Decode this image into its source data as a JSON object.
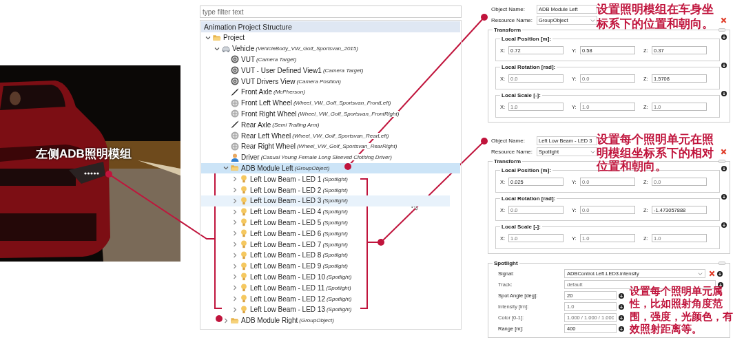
{
  "photo_caption": "左侧ADB照明模组",
  "filter": {
    "placeholder": "type filter text"
  },
  "tree": {
    "title": "Animation Project Structure",
    "items": [
      {
        "label": "Project",
        "kind": "folder",
        "expandable": true,
        "expanded": true,
        "selected": false,
        "hovered": false,
        "children": [
          {
            "label": "Vehicle",
            "type": "(VehicleBody_VW_Golf_Sportsvan_2015)",
            "kind": "car",
            "expandable": true,
            "expanded": true,
            "selected": false,
            "hovered": false,
            "children": [
              {
                "label": "VUT",
                "type": "(Camera Target)",
                "kind": "target",
                "expandable": false,
                "selected": false,
                "hovered": false
              },
              {
                "label": "VUT - User Defined View1",
                "type": "(Camera Target)",
                "kind": "target",
                "expandable": false,
                "selected": false,
                "hovered": false
              },
              {
                "label": "VUT Drivers View",
                "type": "(Camera Position)",
                "kind": "target",
                "expandable": false,
                "selected": false,
                "hovered": false
              },
              {
                "label": "Front Axle",
                "type": "(McPherson)",
                "kind": "axle",
                "expandable": false,
                "selected": false,
                "hovered": false
              },
              {
                "label": "Front Left Wheel",
                "type": "(Wheel_VW_Golf_Sportsvan_FrontLeft)",
                "kind": "wheel",
                "expandable": false,
                "selected": false,
                "hovered": false
              },
              {
                "label": "Front Right Wheel",
                "type": "(Wheel_VW_Golf_Sportsvan_FrontRight)",
                "kind": "wheel",
                "expandable": false,
                "selected": false,
                "hovered": false
              },
              {
                "label": "Rear Axle",
                "type": "(Semi Trailing Arm)",
                "kind": "axle",
                "expandable": false,
                "selected": false,
                "hovered": false
              },
              {
                "label": "Rear Left Wheel",
                "type": "(Wheel_VW_Golf_Sportsvan_RearLeft)",
                "kind": "wheel",
                "expandable": false,
                "selected": false,
                "hovered": false
              },
              {
                "label": "Rear Right Wheel",
                "type": "(Wheel_VW_Golf_Sportsvan_RearRight)",
                "kind": "wheel",
                "expandable": false,
                "selected": false,
                "hovered": false
              },
              {
                "label": "Driver",
                "type": "(Casual Young Female Long Sleeved Clothing Driver)",
                "kind": "person",
                "expandable": false,
                "selected": false,
                "hovered": false
              },
              {
                "label": "ADB Module Left",
                "type": "(GroupObject)",
                "kind": "folder",
                "expandable": true,
                "expanded": true,
                "selected": true,
                "hovered": false,
                "children": [
                  {
                    "label": "Left Low Beam - LED 1",
                    "type": "(Spotlight)",
                    "kind": "bulb",
                    "expandable": true,
                    "expanded": false,
                    "selected": false,
                    "hovered": false
                  },
                  {
                    "label": "Left Low Beam - LED 2",
                    "type": "(Spotlight)",
                    "kind": "bulb",
                    "expandable": true,
                    "expanded": false,
                    "selected": false,
                    "hovered": false
                  },
                  {
                    "label": "Left Low Beam - LED 3",
                    "type": "(Spotlight)",
                    "kind": "bulb",
                    "expandable": true,
                    "expanded": false,
                    "selected": false,
                    "hovered": true
                  },
                  {
                    "label": "Left Low Beam - LED 4",
                    "type": "(Spotlight)",
                    "kind": "bulb",
                    "expandable": true,
                    "expanded": false,
                    "selected": false,
                    "hovered": false
                  },
                  {
                    "label": "Left Low Beam - LED 5",
                    "type": "(Spotlight)",
                    "kind": "bulb",
                    "expandable": true,
                    "expanded": false,
                    "selected": false,
                    "hovered": false
                  },
                  {
                    "label": "Left Low Beam - LED 6",
                    "type": "(Spotlight)",
                    "kind": "bulb",
                    "expandable": true,
                    "expanded": false,
                    "selected": false,
                    "hovered": false
                  },
                  {
                    "label": "Left Low Beam - LED 7",
                    "type": "(Spotlight)",
                    "kind": "bulb",
                    "expandable": true,
                    "expanded": false,
                    "selected": false,
                    "hovered": false
                  },
                  {
                    "label": "Left Low Beam - LED 8",
                    "type": "(Spotlight)",
                    "kind": "bulb",
                    "expandable": true,
                    "expanded": false,
                    "selected": false,
                    "hovered": false
                  },
                  {
                    "label": "Left Low Beam - LED 9",
                    "type": "(Spotlight)",
                    "kind": "bulb",
                    "expandable": true,
                    "expanded": false,
                    "selected": false,
                    "hovered": false
                  },
                  {
                    "label": "Left Low Beam - LED 10",
                    "type": "(Spotlight)",
                    "kind": "bulb",
                    "expandable": true,
                    "expanded": false,
                    "selected": false,
                    "hovered": false
                  },
                  {
                    "label": "Left Low Beam - LED 11",
                    "type": "(Spotlight)",
                    "kind": "bulb",
                    "expandable": true,
                    "expanded": false,
                    "selected": false,
                    "hovered": false
                  },
                  {
                    "label": "Left Low Beam - LED 12",
                    "type": "(Spotlight)",
                    "kind": "bulb",
                    "expandable": true,
                    "expanded": false,
                    "selected": false,
                    "hovered": false
                  },
                  {
                    "label": "Left Low Beam - LED 13",
                    "type": "(Spotlight)",
                    "kind": "bulb",
                    "expandable": true,
                    "expanded": false,
                    "selected": false,
                    "hovered": false
                  }
                ]
              },
              {
                "label": "ADB Module Right",
                "type": "(GroupObject)",
                "kind": "folder",
                "expandable": true,
                "expanded": false,
                "selected": false,
                "hovered": false
              }
            ]
          }
        ]
      }
    ]
  },
  "panels": [
    {
      "object_name_label": "Object Name:",
      "object_name": "ADB Module Left",
      "resource_name_label": "Resource Name:",
      "resource_name": "GroupObject",
      "transform": {
        "title": "Transform",
        "groups": [
          {
            "title": "Local Position [m]:",
            "fields": [
              {
                "axis": "X:",
                "value": "0.72",
                "disabled": false
              },
              {
                "axis": "Y:",
                "value": "0.58",
                "disabled": false
              },
              {
                "axis": "Z:",
                "value": "0.37",
                "disabled": false
              }
            ]
          },
          {
            "title": "Local Rotation [rad]:",
            "fields": [
              {
                "axis": "X:",
                "value": "0.0",
                "disabled": true
              },
              {
                "axis": "Y:",
                "value": "0.0",
                "disabled": true
              },
              {
                "axis": "Z:",
                "value": "1.5708",
                "disabled": false
              }
            ]
          },
          {
            "title": "Local Scale [-]:",
            "fields": [
              {
                "axis": "X:",
                "value": "1.0",
                "disabled": true
              },
              {
                "axis": "Y:",
                "value": "1.0",
                "disabled": true
              },
              {
                "axis": "Z:",
                "value": "1.0",
                "disabled": true
              }
            ]
          }
        ]
      }
    },
    {
      "object_name_label": "Object Name:",
      "object_name": "Left Low Beam - LED 3",
      "resource_name_label": "Resource Name:",
      "resource_name": "Spotlight",
      "transform": {
        "title": "Transform",
        "groups": [
          {
            "title": "Local Position [m]:",
            "fields": [
              {
                "axis": "X:",
                "value": "0.025",
                "disabled": false
              },
              {
                "axis": "Y:",
                "value": "0.0",
                "disabled": true
              },
              {
                "axis": "Z:",
                "value": "0.0",
                "disabled": true
              }
            ]
          },
          {
            "title": "Local Rotation [rad]:",
            "fields": [
              {
                "axis": "X:",
                "value": "0.0",
                "disabled": true
              },
              {
                "axis": "Y:",
                "value": "0.0",
                "disabled": true
              },
              {
                "axis": "Z:",
                "value": "-1.473057888",
                "disabled": false
              }
            ]
          },
          {
            "title": "Local Scale [-]:",
            "fields": [
              {
                "axis": "X:",
                "value": "1.0",
                "disabled": true
              },
              {
                "axis": "Y:",
                "value": "1.0",
                "disabled": true
              },
              {
                "axis": "Z:",
                "value": "1.0",
                "disabled": true
              }
            ]
          }
        ]
      },
      "spotlight": {
        "title": "Spotlight",
        "rows": [
          {
            "kind": "dropdown",
            "label": "Signal:",
            "value": "ADBControl.Left.LED3.intensity",
            "disabled": false
          },
          {
            "kind": "field",
            "label": "Track:",
            "value": "default",
            "disabled": true
          },
          {
            "kind": "field",
            "label": "Spot Angle [deg]:",
            "value": "20",
            "disabled": false
          },
          {
            "kind": "field",
            "label": "Intensity [lm]:",
            "value": "1.0",
            "disabled": true
          },
          {
            "kind": "field",
            "label": "Color [0-1]:",
            "value": "1.000 / 1.000 / 1.000",
            "disabled": true
          },
          {
            "kind": "field",
            "label": "Range [m]:",
            "value": "400",
            "disabled": false
          }
        ]
      }
    }
  ],
  "callouts": [
    "设置照明模组在车身坐标系下的位置和朝向。",
    "设置每个照明单元在照明模组坐标系下的相对位置和朝向。",
    "设置每个照明单元属性，比如照射角度范围，强度，光颜色，有效照射距离等。"
  ]
}
